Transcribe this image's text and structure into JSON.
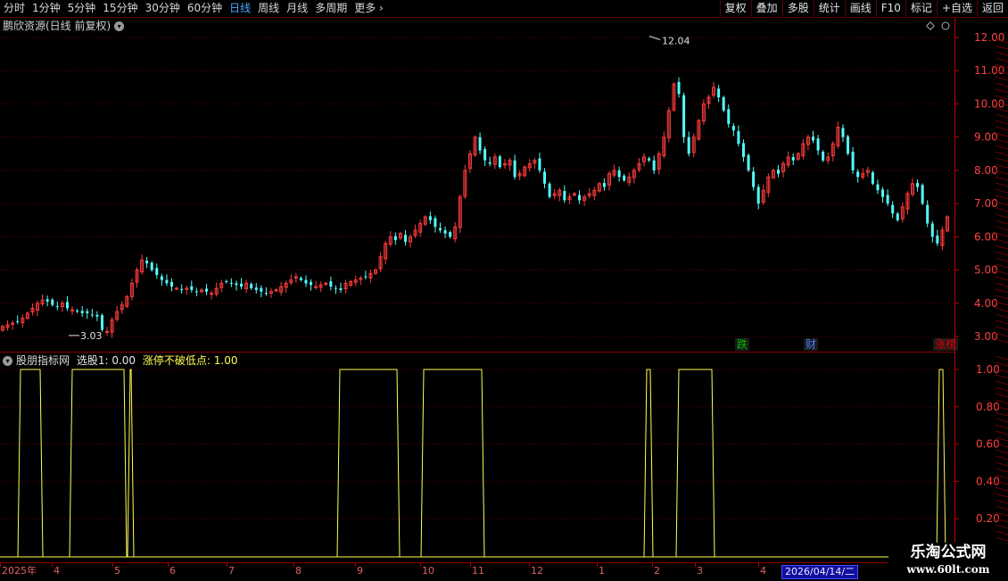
{
  "toolbar": {
    "periods": [
      "分时",
      "1分钟",
      "5分钟",
      "15分钟",
      "30分钟",
      "60分钟",
      "日线",
      "周线",
      "月线",
      "多周期",
      "更多"
    ],
    "active_period": "日线",
    "buttons": [
      "复权",
      "叠加",
      "多股",
      "统计",
      "画线",
      "F10",
      "标记",
      "+自选",
      "返回"
    ]
  },
  "main_panel": {
    "title": "鹏欣资源(日线 前复权)",
    "price_labels": [
      "12.00",
      "11.00",
      "10.00",
      "9.00",
      "8.00",
      "7.00",
      "6.00",
      "5.00",
      "4.00",
      "3.00"
    ],
    "high_marker": "12.04",
    "low_marker": "3.03",
    "tags": [
      {
        "text": "跌",
        "color": "#00c000"
      },
      {
        "text": "财",
        "color": "#4a7fff"
      },
      {
        "text": "涨榜",
        "color": "#e00000"
      }
    ]
  },
  "indicator_panel": {
    "name": "股朋指标网",
    "line1_label": "选股1: 0.00",
    "line2_label": "涨停不破低点: 1.00",
    "y_labels": [
      "1.00",
      "0.80",
      "0.60",
      "0.40",
      "0.20"
    ]
  },
  "time_axis": {
    "months": [
      "2025年",
      "4",
      "5",
      "6",
      "7",
      "8",
      "9",
      "10",
      "11",
      "12",
      "1",
      "2",
      "3",
      "4"
    ],
    "current_date": "2026/04/14/二"
  },
  "watermark": {
    "line1": "乐淘公式网",
    "line2": "www.60lt.com"
  },
  "colors": {
    "up": "#ff3c3c",
    "down": "#52ffff",
    "signal": "#ffff55",
    "grid": "#8b0000"
  },
  "chart_data": {
    "type": "candlestick",
    "price_range": [
      2.85,
      12.3
    ],
    "closes": [
      3.3,
      3.35,
      3.4,
      3.45,
      3.55,
      3.7,
      3.85,
      4.0,
      4.1,
      4.05,
      3.95,
      3.9,
      4.0,
      3.85,
      3.8,
      3.75,
      3.7,
      3.7,
      3.65,
      3.6,
      3.2,
      3.15,
      3.5,
      3.75,
      3.95,
      4.2,
      4.6,
      5.0,
      5.3,
      5.2,
      5.0,
      4.85,
      4.7,
      4.6,
      4.5,
      4.45,
      4.4,
      4.45,
      4.4,
      4.35,
      4.4,
      4.35,
      4.3,
      4.45,
      4.6,
      4.65,
      4.6,
      4.55,
      4.5,
      4.6,
      4.45,
      4.4,
      4.35,
      4.3,
      4.35,
      4.4,
      4.5,
      4.6,
      4.7,
      4.8,
      4.7,
      4.6,
      4.55,
      4.5,
      4.55,
      4.6,
      4.5,
      4.45,
      4.4,
      4.6,
      4.65,
      4.7,
      4.75,
      4.8,
      4.9,
      5.0,
      5.4,
      5.8,
      6.0,
      5.9,
      6.1,
      5.85,
      6.0,
      6.2,
      6.4,
      6.6,
      6.5,
      6.3,
      6.2,
      6.1,
      6.0,
      6.3,
      7.2,
      8.0,
      8.5,
      9.0,
      8.6,
      8.3,
      8.2,
      8.4,
      8.1,
      8.2,
      8.3,
      7.8,
      7.9,
      8.1,
      8.2,
      8.3,
      8.0,
      7.6,
      7.2,
      7.3,
      7.4,
      7.1,
      7.2,
      7.3,
      7.1,
      7.2,
      7.3,
      7.4,
      7.6,
      7.5,
      7.9,
      8.0,
      7.8,
      7.7,
      7.8,
      8.0,
      8.2,
      8.4,
      8.3,
      8.0,
      8.5,
      9.0,
      9.8,
      10.6,
      10.3,
      9.0,
      8.5,
      9.0,
      9.5,
      10.0,
      10.2,
      10.5,
      10.2,
      9.8,
      9.4,
      9.2,
      8.8,
      8.4,
      8.0,
      7.5,
      7.0,
      7.4,
      7.8,
      8.0,
      7.9,
      8.2,
      8.4,
      8.3,
      8.5,
      8.8,
      9.0,
      8.9,
      8.6,
      8.3,
      8.4,
      8.8,
      9.3,
      9.0,
      8.5,
      8.0,
      7.8,
      7.9,
      8.0,
      7.6,
      7.4,
      7.2,
      7.0,
      6.7,
      6.5,
      6.9,
      7.3,
      7.6,
      7.5,
      7.0,
      6.4,
      6.0,
      5.8,
      6.2,
      6.6
    ],
    "signal_segments": [
      [
        20,
        48
      ],
      [
        78,
        142
      ],
      [
        143,
        150
      ],
      [
        378,
        448
      ],
      [
        472,
        543
      ],
      [
        722,
        732
      ],
      [
        758,
        801
      ],
      [
        1050,
        1060
      ]
    ],
    "ylim": [
      0,
      1
    ]
  }
}
